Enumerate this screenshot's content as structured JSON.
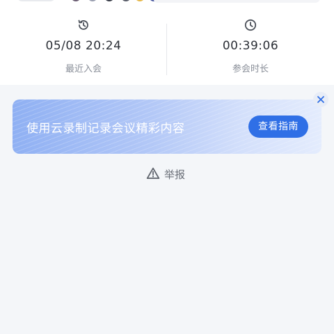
{
  "stats": [
    {
      "icon": "history-icon",
      "value": "05/08 20:24",
      "label": "最近入会"
    },
    {
      "icon": "clock-icon",
      "value": "00:39:06",
      "label": "参会时长"
    }
  ],
  "banner": {
    "text": "使用云录制记录会议精彩内容",
    "button_label": "查看指南",
    "close_icon": "close-icon"
  },
  "report": {
    "icon": "warning-icon",
    "label": "举报"
  },
  "colors": {
    "accent": "#2f6fe6",
    "background": "#f4f6f9"
  }
}
